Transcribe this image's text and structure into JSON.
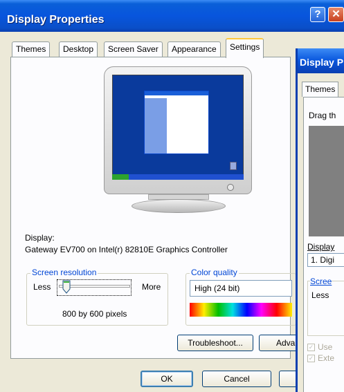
{
  "window": {
    "title": "Display Properties"
  },
  "tabs": [
    "Themes",
    "Desktop",
    "Screen Saver",
    "Appearance",
    "Settings"
  ],
  "active_tab": "Settings",
  "display": {
    "label": "Display:",
    "value": "Gateway EV700 on Intel(r) 82810E Graphics Controller"
  },
  "resolution": {
    "legend": "Screen resolution",
    "less": "Less",
    "more": "More",
    "value_text": "800 by 600 pixels",
    "level": 0.0
  },
  "color_quality": {
    "legend": "Color quality",
    "selected": "High (24 bit)"
  },
  "buttons": {
    "troubleshoot": "Troubleshoot...",
    "advanced": "Adva",
    "ok": "OK",
    "cancel": "Cancel"
  },
  "second_window": {
    "title": "Display P",
    "tab": "Themes",
    "drag_text": "Drag th",
    "display_label": "Display",
    "display_select": "1. Digi",
    "group_legend": "Scree",
    "less": "Less",
    "checkbox1": "Use",
    "checkbox2": "Exte"
  },
  "colors": {
    "titlebar": "#0855dd",
    "active_tab_accent": "#ffc83c",
    "dialog_bg": "#ece9d8",
    "screen_bg": "#0a3a9c"
  }
}
